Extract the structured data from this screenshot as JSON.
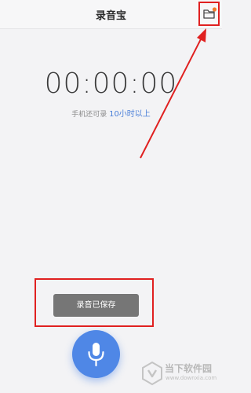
{
  "header": {
    "title": "录音宝",
    "folder_icon": "folder-icon",
    "notification_dot_color": "#f07b2a"
  },
  "recorder": {
    "timer": "00:00:00",
    "remaining_prefix": "手机还可录",
    "remaining_value": "10小时以上"
  },
  "toast": {
    "message": "录音已保存"
  },
  "record_button": {
    "icon": "microphone-icon",
    "color": "#4f87e6"
  },
  "annotation": {
    "color": "#e02020"
  },
  "watermark": {
    "name": "当下软件园",
    "url": "www.downxia.com"
  }
}
